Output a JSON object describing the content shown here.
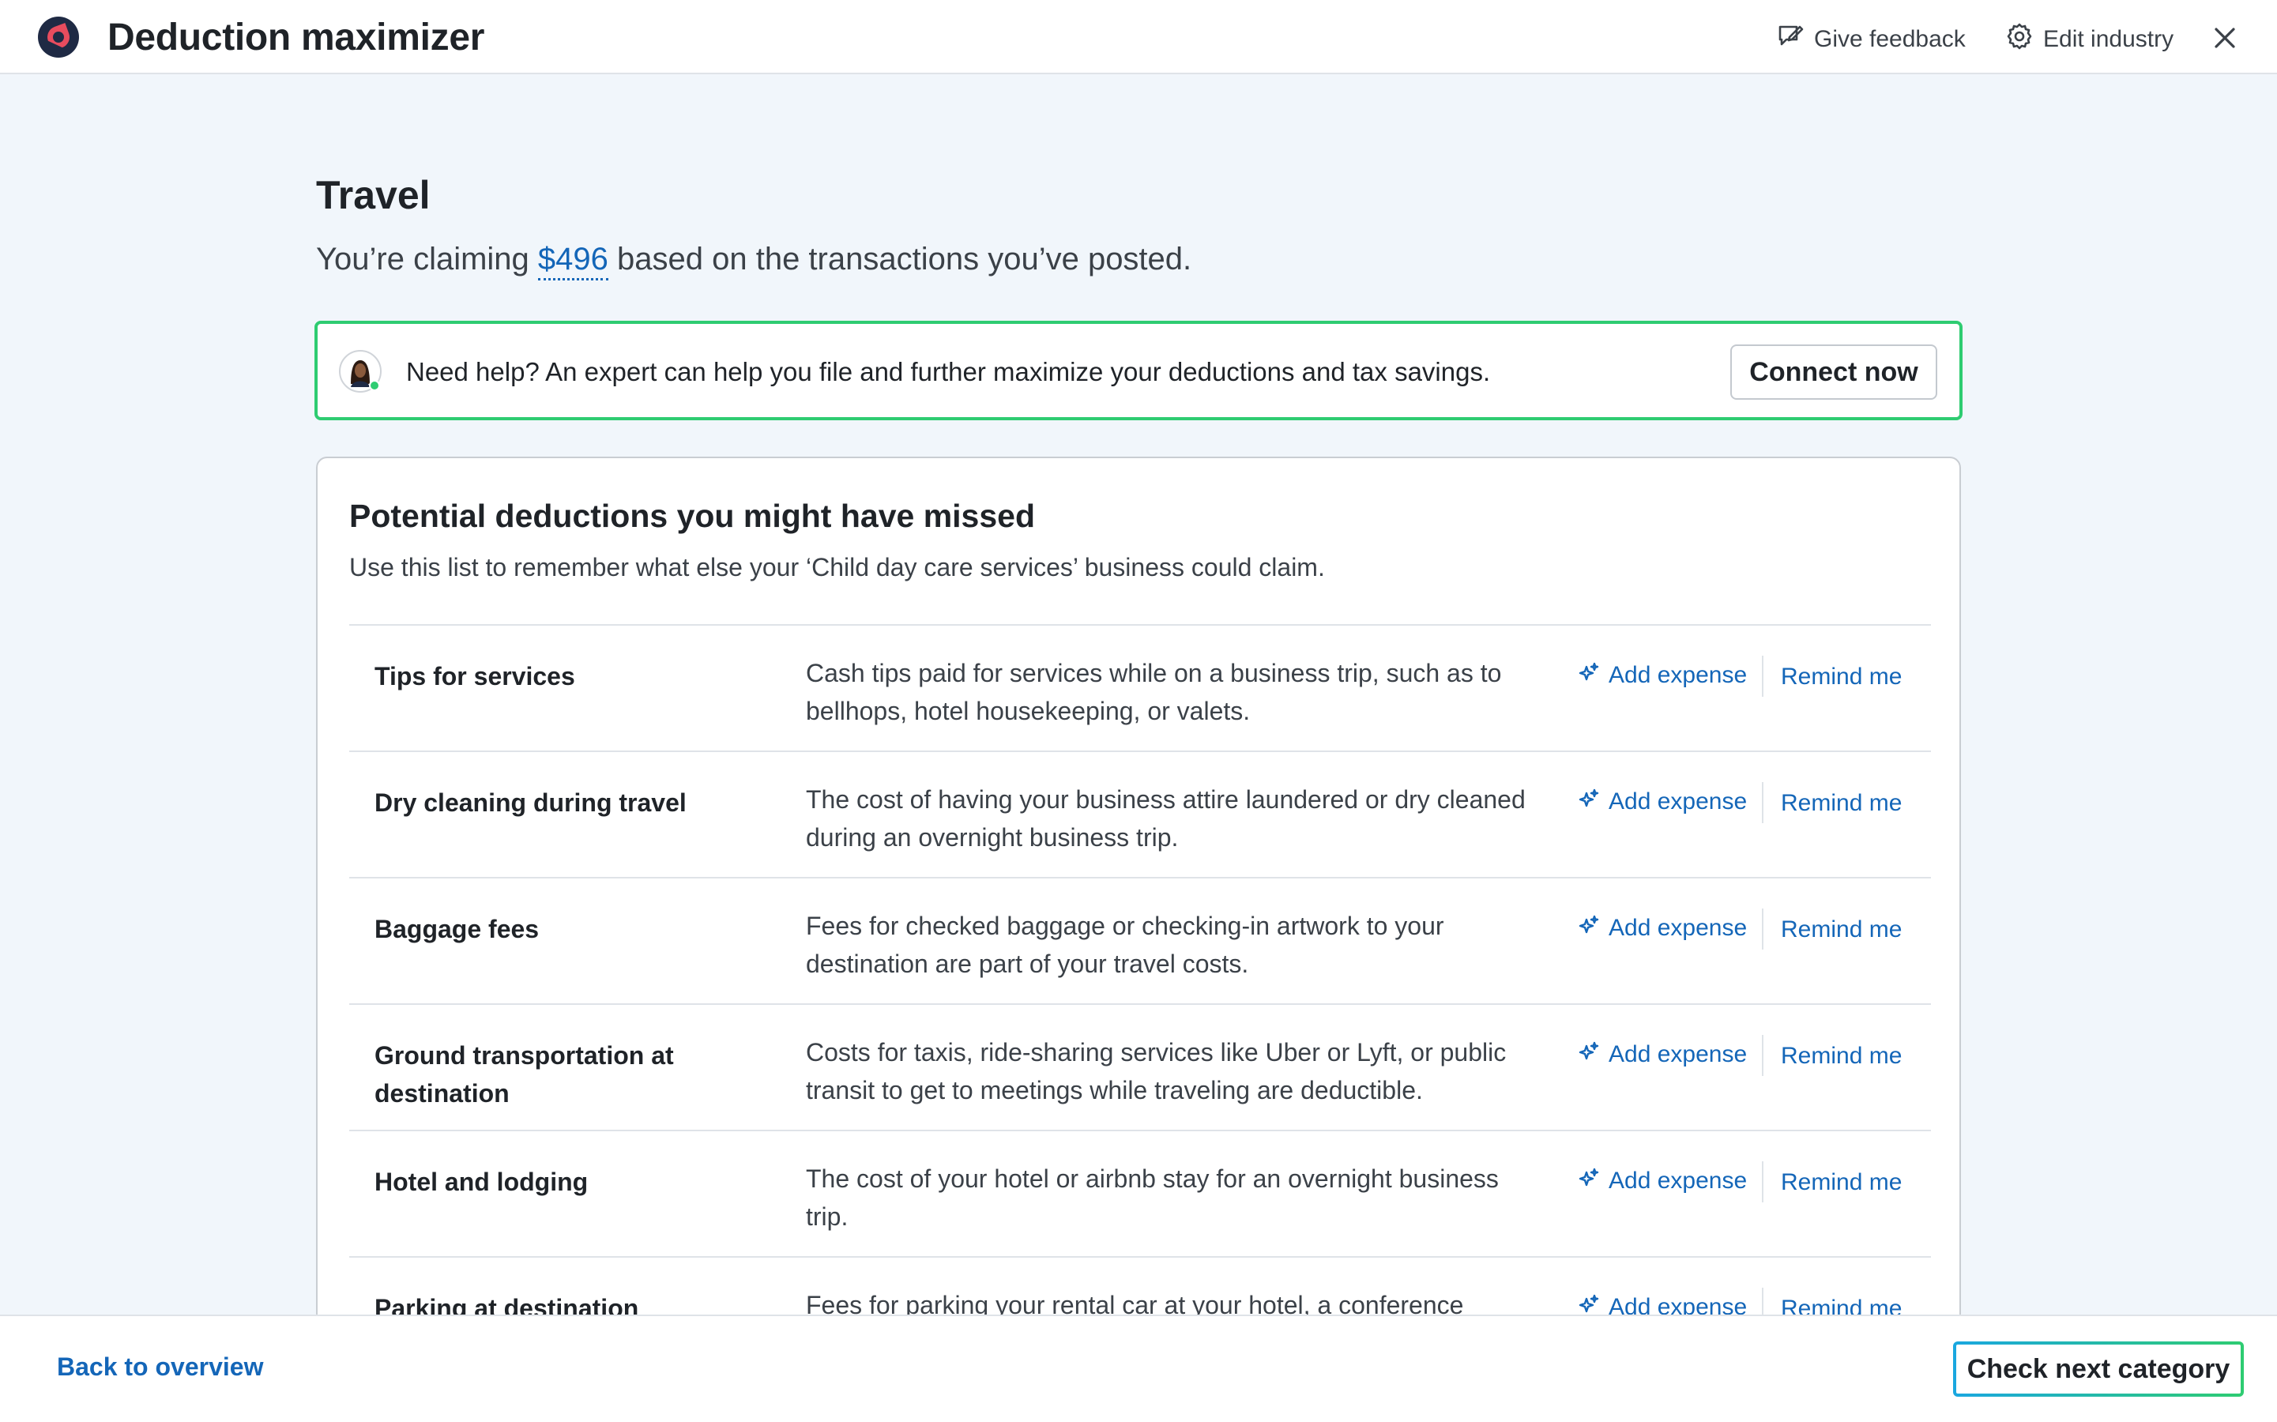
{
  "header": {
    "title": "Deduction maximizer",
    "feedback_label": "Give feedback",
    "industry_label": "Edit industry"
  },
  "main": {
    "section_title": "Travel",
    "summary_before": "You’re claiming ",
    "summary_amount": "$496",
    "summary_after": " based on the transactions you’ve posted."
  },
  "help_banner": {
    "text": "Need help? An expert can help you file and further maximize your deductions and tax savings.",
    "button_label": "Connect now"
  },
  "card": {
    "title": "Potential deductions you might have missed",
    "subtitle": "Use this list to remember what else your ‘Child day care services’ business could claim.",
    "add_expense_label": "Add expense",
    "remind_label": "Remind me",
    "rows": [
      {
        "name": "Tips for services",
        "description": "Cash tips paid for services while on a business trip, such as to bellhops, hotel housekeeping, or valets."
      },
      {
        "name": "Dry cleaning during travel",
        "description": "The cost of having your business attire laundered or dry cleaned during an overnight business trip."
      },
      {
        "name": "Baggage fees",
        "description": "Fees for checked baggage or checking-in artwork to your destination are part of your travel costs."
      },
      {
        "name": "Ground transportation at destination",
        "description": "Costs for taxis, ride-sharing services like Uber or Lyft, or public transit to get to meetings while traveling are deductible."
      },
      {
        "name": "Hotel and lodging",
        "description": "The cost of your hotel or airbnb stay for an overnight business trip."
      },
      {
        "name": "Parking at destination",
        "description": "Fees for parking your rental car at your hotel, a conference"
      }
    ]
  },
  "footer": {
    "back_label": "Back to overview",
    "next_label": "Check next category"
  },
  "colors": {
    "accent_blue": "#1466b8",
    "success_green": "#2ecc71",
    "background": "#f1f6fb",
    "brand_dark": "#1f2a44",
    "brand_red": "#e84c5e"
  },
  "icons": {
    "logo": "brand-logo-icon",
    "feedback": "feedback-icon",
    "settings": "gear-icon",
    "close": "close-icon",
    "add_expense": "sparkle-icon",
    "expert": "expert-avatar"
  }
}
